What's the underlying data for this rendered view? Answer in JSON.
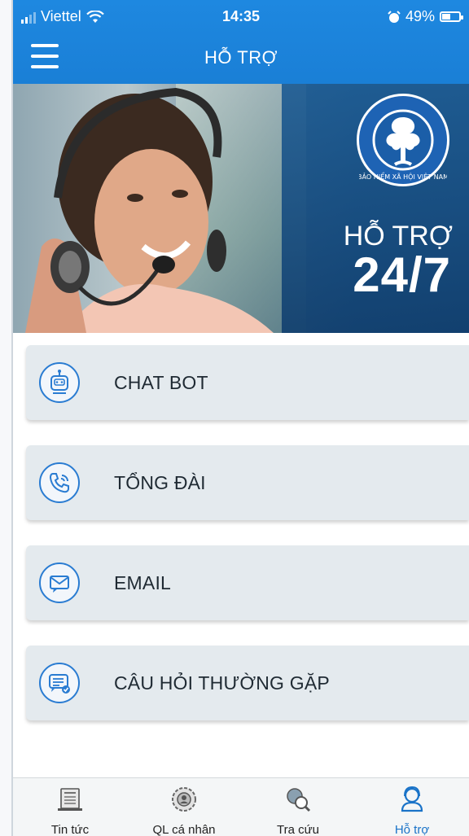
{
  "status_bar": {
    "carrier": "Viettel",
    "time": "14:35",
    "battery": "49%"
  },
  "header": {
    "title": "HỖ TRỢ"
  },
  "banner": {
    "title": "HỖ TRỢ",
    "big": "24/7",
    "logo_text": "BẢO HIỂM XÃ HỘI VIỆT NAM"
  },
  "menu": {
    "items": [
      {
        "label": "CHAT BOT",
        "icon": "chatbot-icon"
      },
      {
        "label": "TỔNG ĐÀI",
        "icon": "phone-icon"
      },
      {
        "label": "EMAIL",
        "icon": "email-icon"
      },
      {
        "label": "CÂU HỎI THƯỜNG GẶP",
        "icon": "faq-icon"
      }
    ]
  },
  "tabs": [
    {
      "label": "Tin tức",
      "icon": "news-icon"
    },
    {
      "label": "QL cá nhân",
      "icon": "personal-icon"
    },
    {
      "label": "Tra cứu",
      "icon": "lookup-icon"
    },
    {
      "label": "Hỗ trợ",
      "icon": "support-icon",
      "active": true
    }
  ],
  "colors": {
    "header": "#1e88e0",
    "accent": "#1a73c8",
    "card": "#e4eaee"
  }
}
